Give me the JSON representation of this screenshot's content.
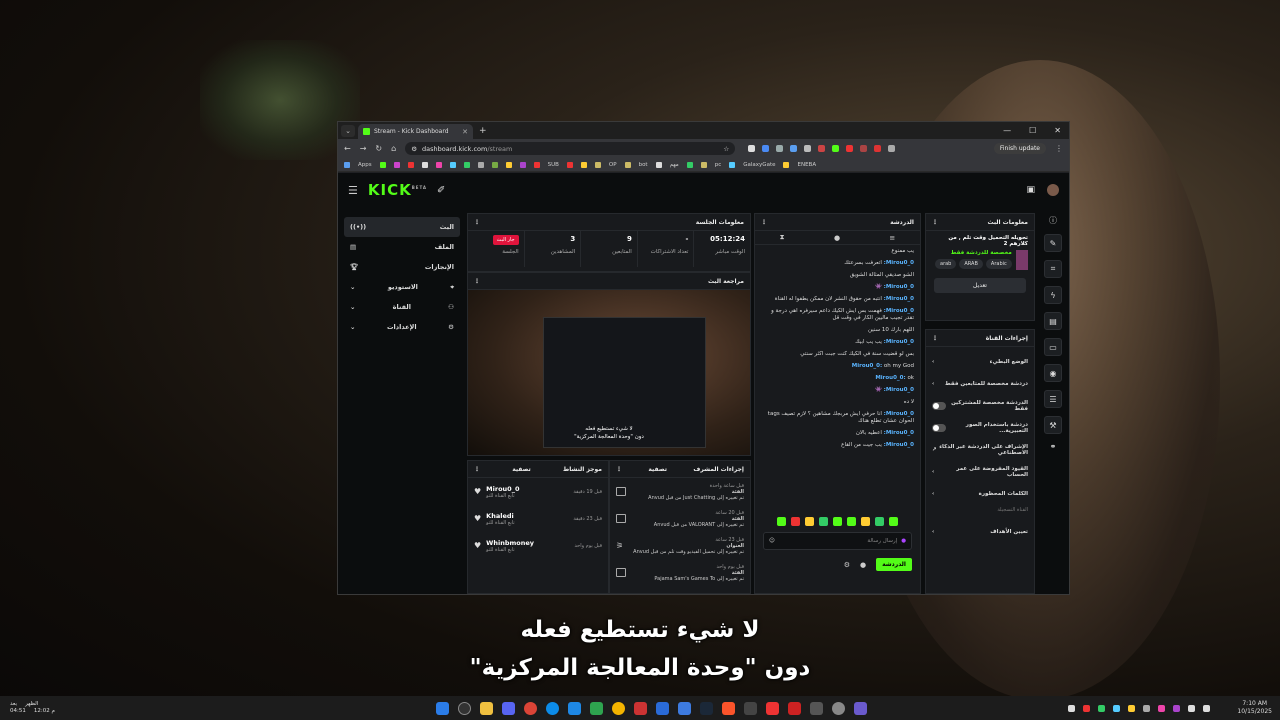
{
  "subtitle": {
    "line1": "لا شيء تستطيع فعله",
    "line2": "دون \"وحدة المعالجة المركزية\""
  },
  "browser": {
    "tab_title": "Stream - Kick Dashboard",
    "url_host": "dashboard.kick.com",
    "url_path": "/stream",
    "finish_update": "Finish update",
    "bookmarks": [
      "Apps",
      "SUB",
      "OP",
      "bot",
      "مهم",
      "pc",
      "GalaxyGate",
      "ENEBA"
    ]
  },
  "kick": {
    "logo": "KICK",
    "logo_beta": "BETA",
    "sidebar": [
      {
        "label": "البث",
        "active": true
      },
      {
        "label": "الملف"
      },
      {
        "label": "الإنجازات"
      },
      {
        "label": "الاستوديو"
      },
      {
        "label": "القناة"
      },
      {
        "label": "الإعدادات"
      }
    ],
    "session": {
      "title": "معلومات الجلسة",
      "live_badge": "جار البث",
      "live_caption": "الجلسة",
      "stats": [
        {
          "value": "3",
          "label": "المشاهدين"
        },
        {
          "value": "9",
          "label": "المتابعين"
        },
        {
          "value": "-",
          "label": "تعداد الاشتراكات"
        },
        {
          "value": "05:12:24",
          "label": "الوقت مباشر"
        }
      ]
    },
    "preview": {
      "title": "مراجعة البث",
      "caption1": "لا شيء تستطيع فعله",
      "caption2": "دون \"وحدة المعالجة المركزية\""
    },
    "activity_feed": {
      "title": "موجز النشاط",
      "filter": "تصفية",
      "items": [
        {
          "name": "Mirou0_0",
          "sub": "تابع القناة للتو",
          "time": "قبل 19 دقيقة"
        },
        {
          "name": "Khaledi",
          "sub": "تابع القناة للتو",
          "time": "قبل 23 دقيقة"
        },
        {
          "name": "Whinbmoney",
          "sub": "تابع القناة للتو",
          "time": "قبل يوم واحد"
        }
      ]
    },
    "mod_actions": {
      "title": "إجراءات المشرف",
      "filter": "تصفية",
      "items": [
        {
          "time": "قبل ساعة واحدة",
          "head": "الفئة",
          "text": "تم تغييره إلى Just Chatting من قبل Anvud"
        },
        {
          "time": "قبل 20 ساعة",
          "head": "الفئة",
          "text": "تم تغييره إلى VALORANT من قبل Anvud"
        },
        {
          "time": "قبل 23 ساعة",
          "head": "العنوان",
          "text": "تم تغييره إلى تحميل الفيديو وقت تلم من قبل Anvud"
        },
        {
          "time": "قبل يوم واحد",
          "head": "الفئة",
          "text": "تم تغييره إلى Pajama Sam's Games To"
        }
      ]
    },
    "chat": {
      "title": "الدردشة",
      "messages": [
        {
          "user": "",
          "text": "يب ممنوع"
        },
        {
          "user": "Mirou0_0:",
          "text": "اتعرفت بسرعتك"
        },
        {
          "user": "",
          "text": "الشو صديقي المثالة الشويق"
        },
        {
          "user": "Mirou0_0:",
          "text": "👾"
        },
        {
          "user": "Mirou0_0:",
          "text": "انتبه من حقوق النشر لان ممكن يطفوا له القناة"
        },
        {
          "user": "Mirou0_0:",
          "text": "فهمت بس ايش الكيك داعم سيرفره اهي درجة و تقدر تجيب ماليين الكار في وقت قل"
        },
        {
          "user": "",
          "text": "اللهم بارك 10 سنين"
        },
        {
          "user": "Mirou0_0:",
          "text": "يب يب ابيك"
        },
        {
          "user": "",
          "text": "بس لو قضيت سنة في الكيك كنت جبت اكثر سنتي"
        },
        {
          "user": "Mirou0_0:",
          "text": "oh my God"
        },
        {
          "user": "Mirou0_0:",
          "text": "ok"
        },
        {
          "user": "Mirou0_0:",
          "text": "👾"
        },
        {
          "user": "",
          "text": "لا ده"
        },
        {
          "user": "Mirou0_0:",
          "text": "انا حرفي ايش مربجك مشاهين ؟ لازم تصيف tags الحوان عشان تطلع هناك"
        },
        {
          "user": "Mirou0_0:",
          "text": "اعطيه بالان"
        },
        {
          "user": "Mirou0_0:",
          "text": "يب جيت من القاع"
        }
      ],
      "input_placeholder": "إرسال رسالة",
      "send_label": "الدردشة"
    },
    "stream_info": {
      "title": "معلومات البث",
      "stream_title": "تحويله التحميل وقت تلم , من كلارهم 2",
      "category": "مخصصة للدردشة فقط",
      "tags": [
        "Arabic",
        "ARAB",
        "arab"
      ],
      "edit_label": "تعديل"
    },
    "channel_actions": {
      "title": "إجراءات القناة",
      "items": [
        {
          "label": "الوضع البطيء",
          "type": "chevron"
        },
        {
          "label": "دردشة مخصصة للمتابعين فقط",
          "type": "chevron"
        },
        {
          "label": "الدردشة مخصصة للمشتركين فقط",
          "type": "toggle"
        },
        {
          "label": "دردشة باستخدام الصور التعبيرية...",
          "type": "toggle"
        },
        {
          "label": "الإشراف على الدردشة عبر الذكاء الاصطناعي",
          "type": "link"
        },
        {
          "label": "القيود المفروضة على عمر الحساب",
          "type": "chevron"
        },
        {
          "label": "الكلمات المحظورة",
          "type": "chevron"
        }
      ],
      "footer_note": "القناة التسجيلة",
      "goals": "تعيين الأهداف"
    }
  },
  "taskbar": {
    "weather_top": "الظهر",
    "weather_bottom": "12:02 م",
    "left_time_top": "بعد",
    "left_time_bottom": "04:51",
    "clock_time": "7:10 AM",
    "clock_date": "10/15/2025"
  }
}
